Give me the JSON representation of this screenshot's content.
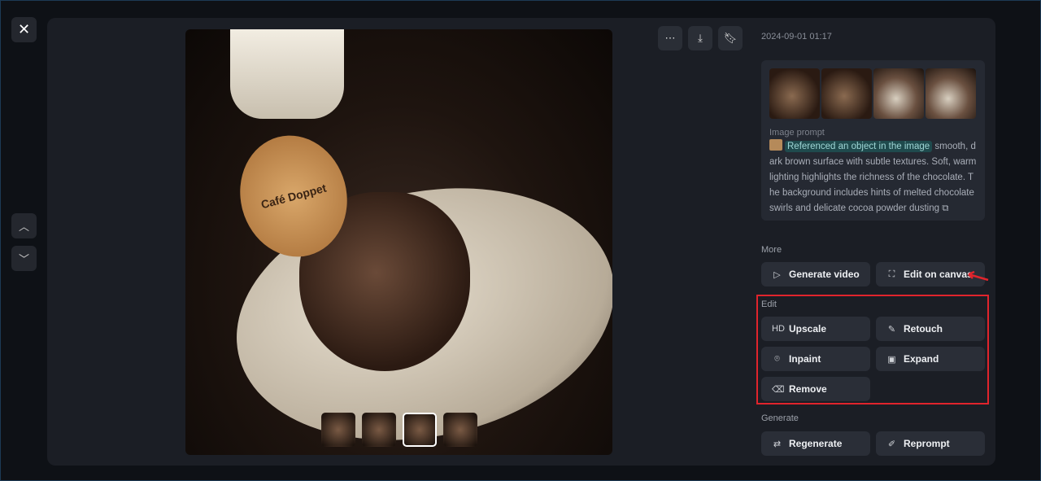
{
  "close_icon": "close-icon",
  "nav": {
    "up": "chevron-up-icon",
    "down": "chevron-down-icon"
  },
  "image": {
    "wafer_text": "Café Doppet",
    "thumbnails": 4,
    "active_thumbnail": 3
  },
  "toolbar": {
    "more": "⋯",
    "download": "download-icon",
    "bookmark": "bookmark-icon"
  },
  "date": "2024-09-01 01:17",
  "prompt": {
    "label": "Image prompt",
    "chip": "Referenced an object in the image",
    "text": " smooth, dark brown surface with subtle textures. Soft, warm lighting highlights the richness of the chocolate. The background includes hints of melted chocolate swirls and delicate cocoa powder dusting"
  },
  "more": {
    "title": "More",
    "generate_video": "Generate video",
    "edit_on_canvas": "Edit on canvas"
  },
  "edit": {
    "title": "Edit",
    "upscale_icon": "HD",
    "upscale": "Upscale",
    "retouch": "Retouch",
    "inpaint": "Inpaint",
    "expand": "Expand",
    "remove": "Remove"
  },
  "generate": {
    "title": "Generate",
    "regenerate": "Regenerate",
    "reprompt": "Reprompt"
  },
  "colors": {
    "highlight": "#e0242c",
    "chip_bg": "#1f4a4d"
  }
}
